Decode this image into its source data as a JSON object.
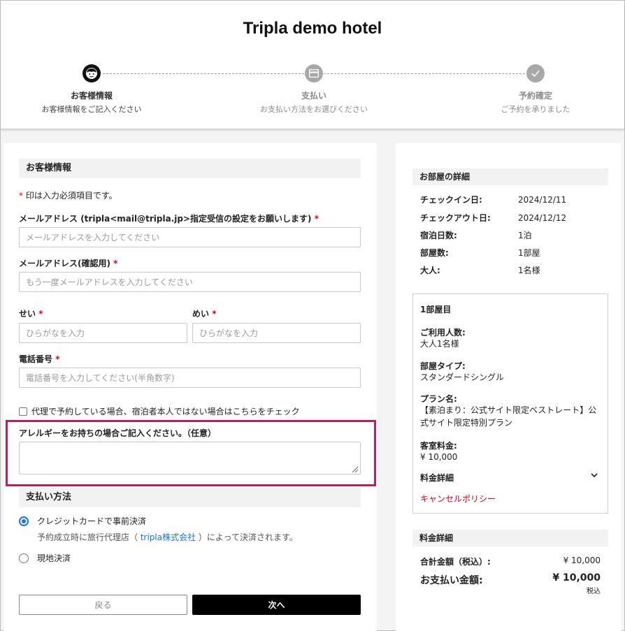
{
  "header": {
    "hotel_name": "Tripla demo hotel",
    "steps": [
      {
        "label": "お客様情報",
        "sub": "お客様情報をご記入ください",
        "state": "active",
        "icon": "face-icon"
      },
      {
        "label": "支払い",
        "sub": "お支払い方法をお選びください",
        "state": "inactive",
        "icon": "card-icon"
      },
      {
        "label": "予約確定",
        "sub": "ご予約を承りました",
        "state": "inactive",
        "icon": "check-icon"
      }
    ]
  },
  "form": {
    "section_title": "お客様情報",
    "required_note_mark": "*",
    "required_note": " 印は入力必須項目です。",
    "required_mark": "*",
    "email_label": "メールアドレス",
    "email_hint": " (tripla<mail@tripla.jp>指定受信の設定をお願いします)",
    "email_placeholder": "メールアドレスを入力してください",
    "email_confirm_label": "メールアドレス(確認用)",
    "email_confirm_placeholder": "もう一度メールアドレスを入力してください",
    "last_name_label": "せい",
    "last_name_placeholder": "ひらがなを入力",
    "first_name_label": "めい",
    "first_name_placeholder": "ひらがなを入力",
    "phone_label": "電話番号",
    "phone_placeholder": "電話番号を入力してください(半角数字)",
    "proxy_checkbox_label": "代理で予約している場合、宿泊者本人ではない場合はこちらをチェック",
    "allergy_label": "アレルギーをお持ちの場合ご記入ください。（任意）"
  },
  "payment": {
    "section_title": "支払い方法",
    "option_card": "クレジットカードで事前決済",
    "note_prefix": "予約成立時に旅行代理店（ ",
    "note_link": "tripla株式会社",
    "note_suffix": " ）によって決済されます。",
    "option_onsite": "現地決済",
    "selected": "option_card"
  },
  "buttons": {
    "back": "戻る",
    "next": "次へ"
  },
  "room_details": {
    "title": "お部屋の詳細",
    "rows": [
      {
        "k": "チェックイン日:",
        "v": "2024/12/11"
      },
      {
        "k": "チェックアウト日:",
        "v": "2024/12/12"
      },
      {
        "k": "宿泊日数:",
        "v": "1泊"
      },
      {
        "k": "部屋数:",
        "v": "1部屋"
      },
      {
        "k": "大人:",
        "v": "1名様"
      }
    ]
  },
  "room1": {
    "title": "1部屋目",
    "guests_label": "ご利用人数:",
    "guests_value": "大人1名様",
    "room_type_label": "部屋タイプ:",
    "room_type_value": "スタンダードシングル",
    "plan_label": "プラン名:",
    "plan_value": "【素泊まり：公式サイト限定ベストレート】公式サイト限定特別プラン",
    "rate_label": "客室料金:",
    "rate_value": "¥ 10,000",
    "fee_detail_label": "料金詳細",
    "cancel_policy": "キャンセルポリシー"
  },
  "fee_summary": {
    "title": "料金詳細",
    "total_label": "合計金額（税込）:",
    "total_value": "¥ 10,000",
    "grand_label": "お支払い金額:",
    "grand_value": "¥ 10,000",
    "tax_note": "税込"
  },
  "colors": {
    "accent_blue": "#1a73e8",
    "required_red": "#d0021b",
    "highlight": "#b3245f"
  }
}
